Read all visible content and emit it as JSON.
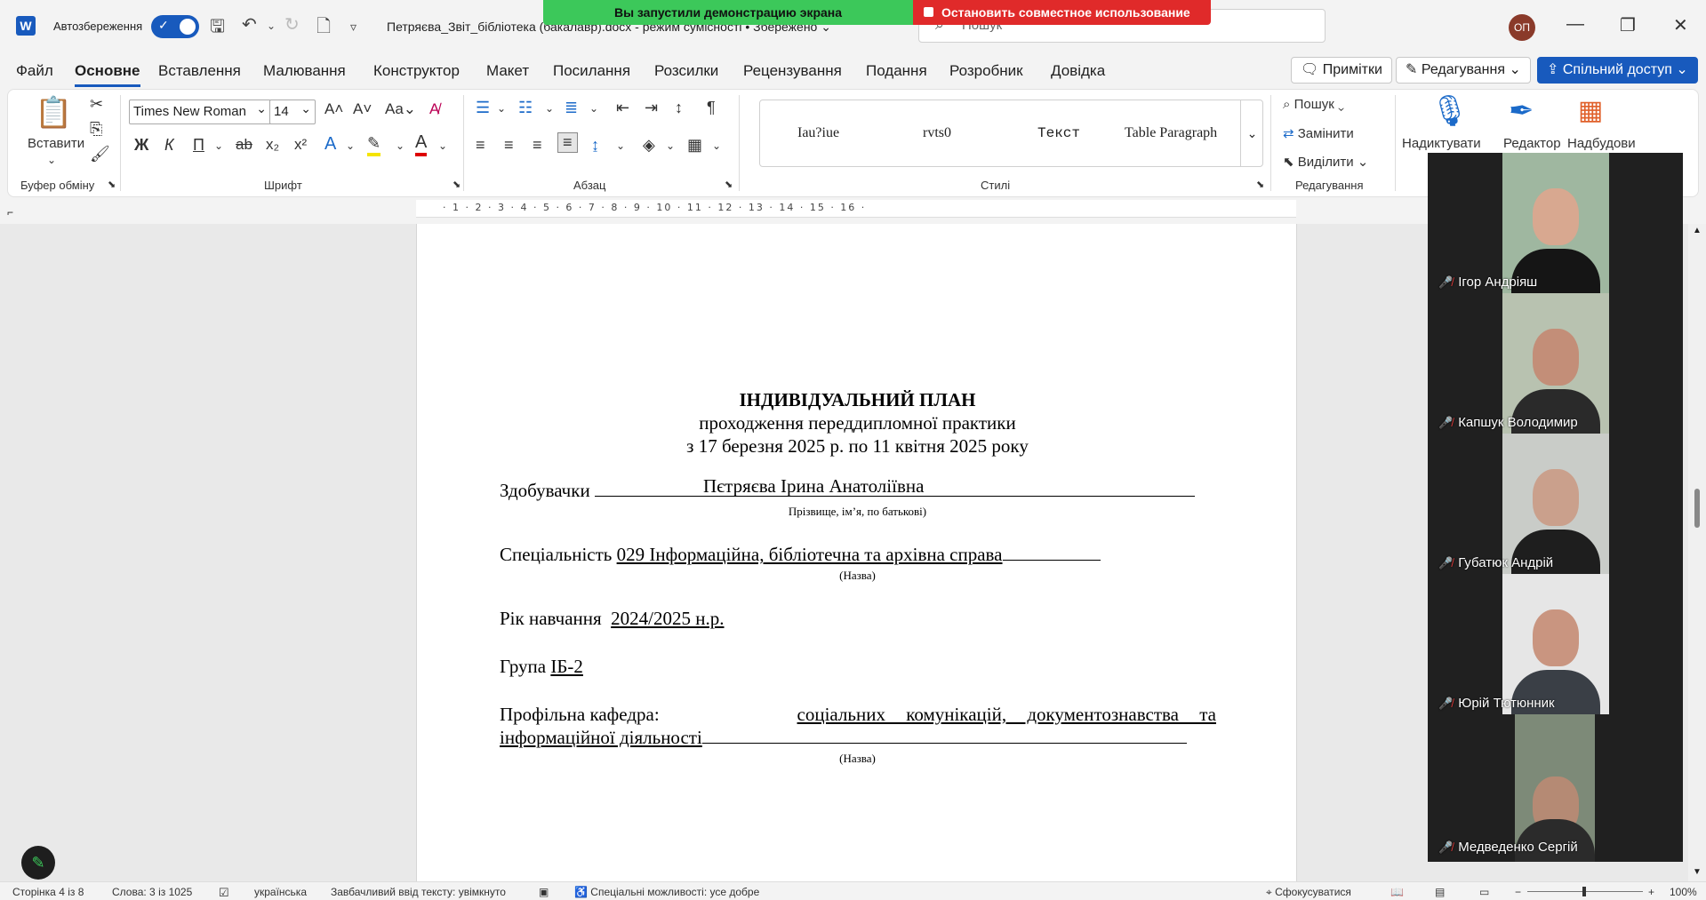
{
  "titlebar": {
    "app_letter": "W",
    "autosave_label": "Автозбереження",
    "doc_title": "Петряєва_Звіт_бібліотека (бакалавр).docx - режим сумісності • Збережено ⌄",
    "search_placeholder": "Пошук",
    "user_initials": "ОП"
  },
  "screen_share": {
    "status_text": "Вы запустили демонстрацию экрана",
    "stop_text": "Остановить совместное использование"
  },
  "menu": {
    "tabs": [
      "Файл",
      "Основне",
      "Вставлення",
      "Малювання",
      "Конструктор",
      "Макет",
      "Посилання",
      "Розсилки",
      "Рецензування",
      "Подання",
      "Розробник",
      "Довідка"
    ],
    "comments_label": "Примітки",
    "editing_label": "Редагування",
    "share_label": "Спільний доступ"
  },
  "ribbon": {
    "paste_label": "Вставити",
    "clipboard_group": "Буфер обміну",
    "font_name": "Times New Roman",
    "font_size": "14",
    "font_group": "Шрифт",
    "paragraph_group": "Абзац",
    "styles_group": "Стилі",
    "styles": [
      "Iau?iue",
      "rvts0",
      "Текст",
      "Table Paragraph"
    ],
    "find_label": "Пошук",
    "replace_label": "Замінити",
    "select_label": "Виділити",
    "editing_group": "Редагування",
    "dictate_label": "Надиктувати",
    "editor_label": "Редактор",
    "addins_label": "Надбудови",
    "bold": "Ж",
    "italic": "К",
    "underline": "П"
  },
  "ruler": {
    "ticks": "· 1 · 2 · 3 · 4 · 5 · 6 · 7 · 8 · 9 · 10 · 11 · 12 · 13 · 14 · 15 · 16 ·"
  },
  "document": {
    "title": "ІНДИВІДУАЛЬНИЙ ПЛАН",
    "subtitle": "проходження переддипломної практики",
    "period": "з 17 березня 2025 р. по 11 квітня 2025 року",
    "student_label": "Здобувачки",
    "student_name": "Пєтряєва Ірина Анатоліївна",
    "student_hint": "Прізвище, ім’я, по батькові)",
    "specialty_label": "Спеціальність",
    "specialty_value": "029 Інформаційна, бібліотечна та архівна справа",
    "name_hint": "(Назва)",
    "year_label": "Рік навчання",
    "year_value": "2024/2025 н.р.",
    "group_label": "Група",
    "group_value": "ІБ-2",
    "dept_label": "Профільна кафедра:",
    "dept_value_1": "соціальних комунікацій, документознавства та",
    "dept_value_2": "інформаційної діяльності",
    "name_hint_2": "(Назва)"
  },
  "participants": [
    {
      "name": "Ігор Андріяш",
      "muted": true
    },
    {
      "name": "Капшук Володимир",
      "muted": true
    },
    {
      "name": "Губатюк Андрій",
      "muted": true
    },
    {
      "name": "Юрій Тютюнник",
      "muted": true
    },
    {
      "name": "Медведенко Сергій",
      "muted": true
    }
  ],
  "statusbar": {
    "page": "Сторінка 4 із 8",
    "words": "Слова: 3 із 1025",
    "language": "українська",
    "predictive": "Завбачливий ввід тексту: увімкнуто",
    "accessibility": "Спеціальні можливості: усе добре",
    "focus": "Сфокусуватися",
    "zoom": "100%"
  }
}
